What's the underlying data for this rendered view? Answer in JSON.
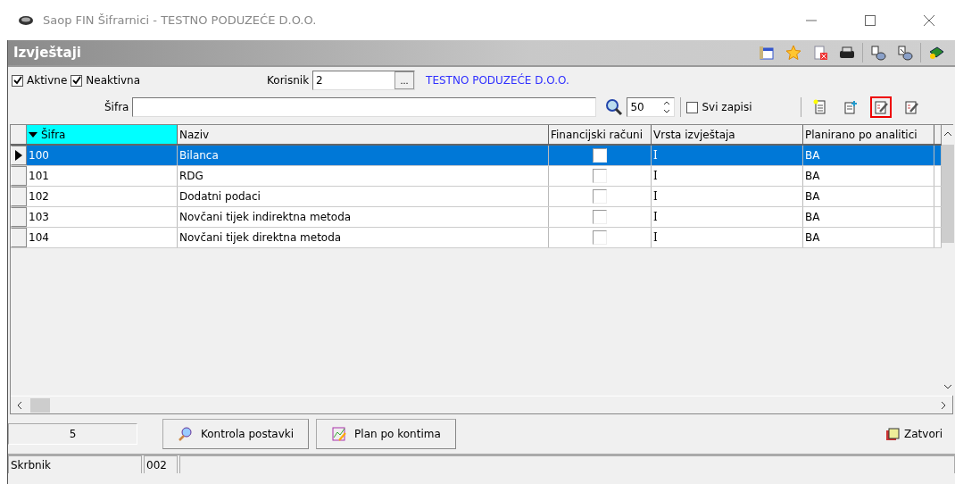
{
  "window": {
    "title": "Saop FIN Šifrarnici - TESTNO PODUZEĆE D.O.O."
  },
  "panel": {
    "title": "Izvještaji",
    "tools": [
      {
        "kind": "layout"
      },
      {
        "kind": "star"
      },
      {
        "kind": "delete"
      },
      {
        "kind": "print"
      },
      {
        "kind": "export"
      },
      {
        "kind": "import"
      },
      {
        "kind": "help"
      }
    ]
  },
  "filters": {
    "active": {
      "label": "Aktivne",
      "checked": true
    },
    "inactive": {
      "label": "Neaktivna",
      "checked": true
    },
    "user_label": "Korisnik",
    "user_value": "2",
    "browse": "...",
    "user_name": "TESTNO PODUZEĆE D.O.O."
  },
  "search": {
    "label": "Šifra",
    "limit": "50",
    "all_records": {
      "label": "Svi zapisi",
      "checked": false
    }
  },
  "record_tools": [
    {
      "kind": "new",
      "highlighted": false
    },
    {
      "kind": "copy",
      "highlighted": false
    },
    {
      "kind": "edit",
      "highlighted": true
    },
    {
      "kind": "edit2",
      "highlighted": false
    }
  ],
  "table": {
    "columns": [
      {
        "label": "Šifra",
        "sorted": true
      },
      {
        "label": "Naziv",
        "sorted": false
      },
      {
        "label": "Financijski računi",
        "sorted": false
      },
      {
        "label": "Vrsta izvještaja",
        "sorted": false
      },
      {
        "label": "Planirano po analitici",
        "sorted": false
      }
    ],
    "rows": [
      {
        "selected": true,
        "code": "100",
        "name": "Bilanca",
        "financial": false,
        "type": "I",
        "plan": "BA"
      },
      {
        "selected": false,
        "code": "101",
        "name": "RDG",
        "financial": false,
        "type": "I",
        "plan": "BA"
      },
      {
        "selected": false,
        "code": "102",
        "name": "Dodatni podaci",
        "financial": false,
        "type": "I",
        "plan": "BA"
      },
      {
        "selected": false,
        "code": "103",
        "name": "Novčani tijek indirektna metoda",
        "financial": false,
        "type": "I",
        "plan": "BA"
      },
      {
        "selected": false,
        "code": "104",
        "name": "Novčani tijek direktna metoda",
        "financial": false,
        "type": "I",
        "plan": "BA"
      }
    ]
  },
  "footer": {
    "count": "5",
    "buttons": [
      {
        "kind": "check",
        "label": "Kontrola postavki"
      },
      {
        "kind": "plan",
        "label": "Plan po kontima"
      }
    ],
    "close": "Zatvori"
  },
  "status_bar": {
    "label": "Skrbnik",
    "value": "002"
  }
}
